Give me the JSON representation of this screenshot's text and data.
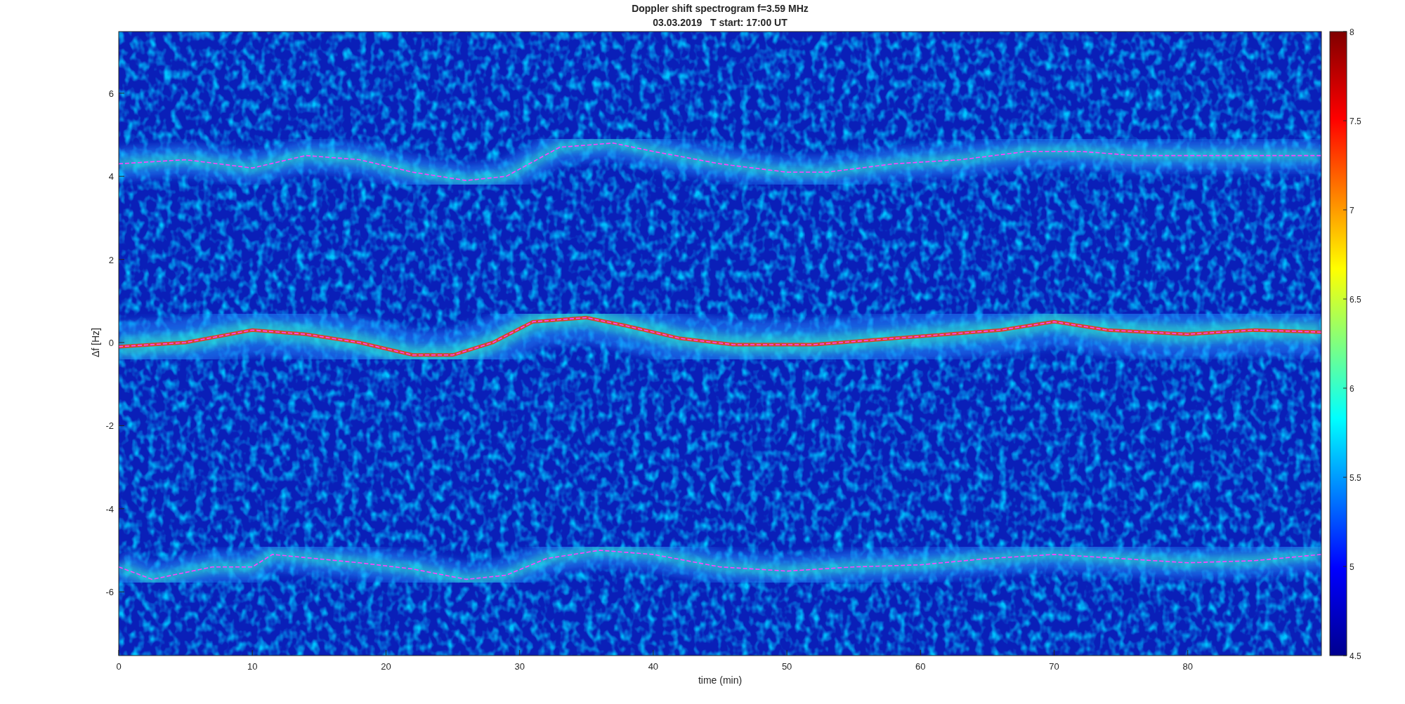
{
  "figure": {
    "title": "Doppler shift spectrogram f=3.59 MHz",
    "subtitle": "03.03.2019   T start: 17:00 UT"
  },
  "axes": {
    "xlabel": "time (min)",
    "ylabel": "Δf [Hz]",
    "xticks": [
      "0",
      "10",
      "20",
      "30",
      "40",
      "50",
      "60",
      "70",
      "80"
    ],
    "yticks": [
      "6",
      "4",
      "2",
      "0",
      "-2",
      "-4",
      "-6"
    ]
  },
  "colorbar": {
    "ticks": [
      "8",
      "7.5",
      "7",
      "6.5",
      "6",
      "5.5",
      "5",
      "4.5"
    ]
  }
}
